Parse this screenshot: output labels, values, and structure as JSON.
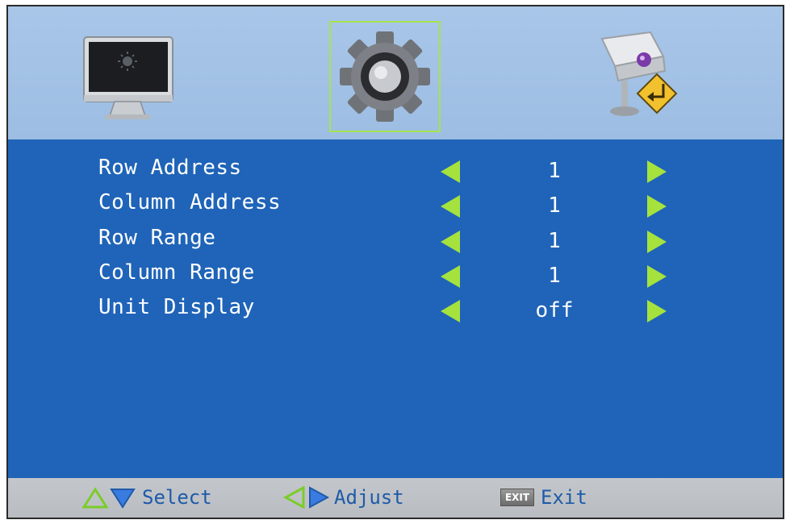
{
  "tabs": [
    {
      "name": "picture",
      "icon": "monitor-icon",
      "selected": false
    },
    {
      "name": "settings",
      "icon": "gear-icon",
      "selected": true
    },
    {
      "name": "camera",
      "icon": "camera-icon",
      "selected": false
    }
  ],
  "menu": {
    "items": [
      {
        "label": "Row Address",
        "value": "1"
      },
      {
        "label": "Column Address",
        "value": "1"
      },
      {
        "label": "Row Range",
        "value": "1"
      },
      {
        "label": "Column Range",
        "value": "1"
      },
      {
        "label": "Unit Display",
        "value": "off"
      }
    ]
  },
  "footer": {
    "select_label": "Select",
    "adjust_label": "Adjust",
    "exit_key": "EXIT",
    "exit_label": "Exit"
  },
  "colors": {
    "background": "#1f64b8",
    "topbar": "#a3c2e6",
    "accent": "#a6e23d",
    "footer_text": "#1e5aa8"
  }
}
